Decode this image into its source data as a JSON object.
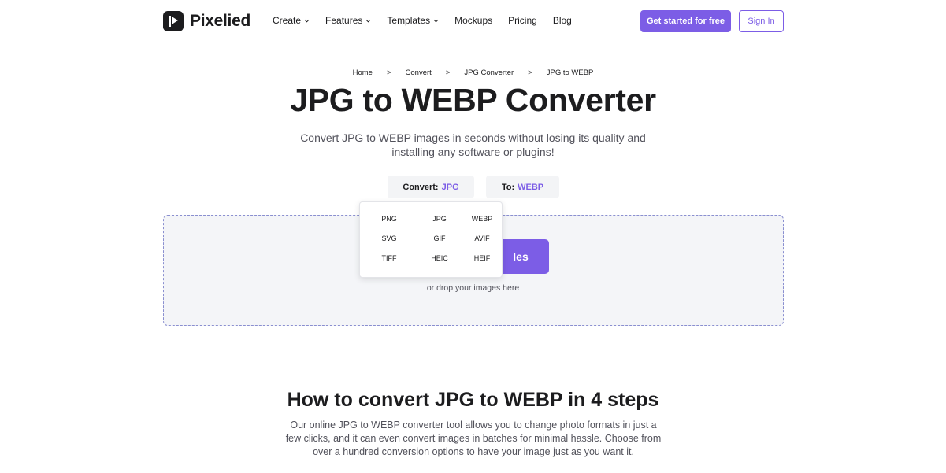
{
  "header": {
    "brand": "Pixelied",
    "nav": [
      {
        "label": "Create",
        "has_chevron": true
      },
      {
        "label": "Features",
        "has_chevron": true
      },
      {
        "label": "Templates",
        "has_chevron": true
      },
      {
        "label": "Mockups",
        "has_chevron": false
      },
      {
        "label": "Pricing",
        "has_chevron": false
      },
      {
        "label": "Blog",
        "has_chevron": false
      }
    ],
    "cta_label": "Get started for free",
    "signin_label": "Sign In"
  },
  "breadcrumb": {
    "items": [
      "Home",
      "Convert",
      "JPG Converter",
      "JPG to WEBP"
    ],
    "separator": ">"
  },
  "page": {
    "title": "JPG to WEBP Converter",
    "subtitle": "Convert JPG to WEBP images in seconds without losing its quality and installing any software or plugins!"
  },
  "converter": {
    "from_label": "Convert:",
    "from_value": "JPG",
    "to_label": "To:",
    "to_value": "WEBP",
    "upload_label": "les",
    "drop_hint": "or drop your images here",
    "dropdown_options": [
      "PNG",
      "JPG",
      "WEBP",
      "SVG",
      "GIF",
      "AVIF",
      "TIFF",
      "HEIC",
      "HEIF"
    ]
  },
  "howto": {
    "title": "How to convert JPG to WEBP in 4 steps",
    "text": "Our online JPG to WEBP converter tool allows you to change photo formats in just a few clicks, and it can even convert images in batches for minimal hassle. Choose from over a hundred conversion options to have your image just as you want it."
  },
  "colors": {
    "accent": "#7c5de6",
    "text": "#1c1c1e",
    "muted": "#52525b",
    "dropzone_bg": "#f4f5f8",
    "select_bg": "#f3f4f6"
  },
  "icons": {
    "logo": "pixelied-logo-icon",
    "chevron": "chevron-down-icon"
  }
}
